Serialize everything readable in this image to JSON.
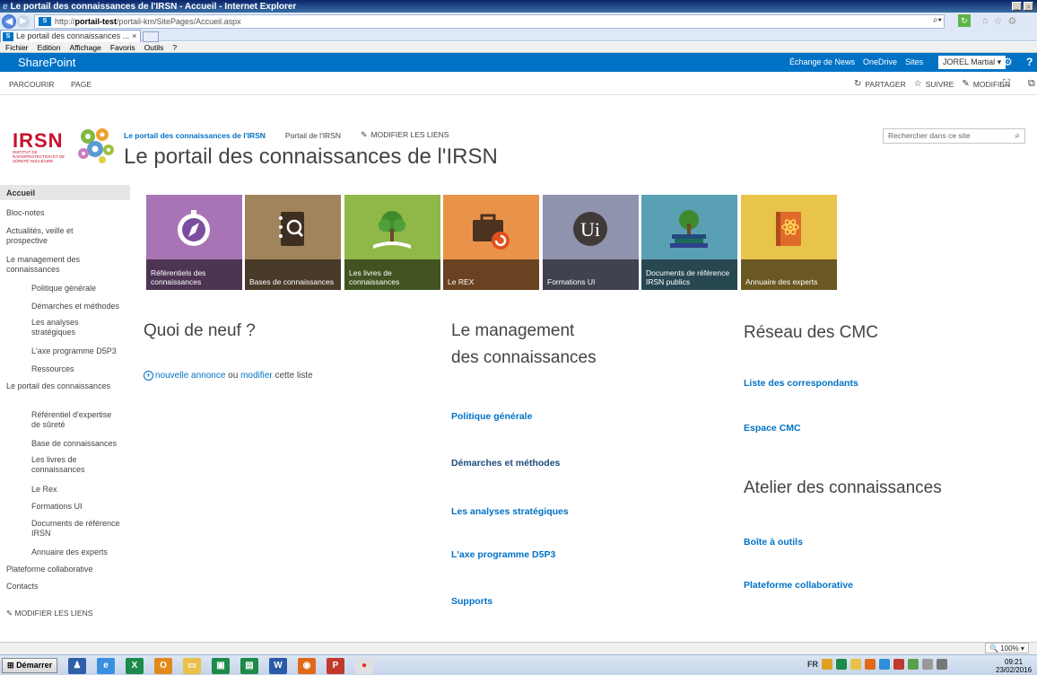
{
  "window": {
    "title": "Le portail des connaissances de l'IRSN - Accueil - Internet Explorer",
    "url_prefix": "http://",
    "url_host": "portail-test",
    "url_path": "/portail-km/SitePages/Accueil.aspx",
    "tab_label": "Le portail des connaissances ...",
    "tab_close": "×",
    "menu": [
      "Fichier",
      "Edition",
      "Affichage",
      "Favoris",
      "Outils",
      "?"
    ]
  },
  "suitebar": {
    "brand": "SharePoint",
    "links": [
      "Échange de News",
      "OneDrive",
      "Sites"
    ],
    "user": "JOREL Martial ▾",
    "help": "?"
  },
  "ribbon": {
    "tabs": [
      "PARCOURIR",
      "PAGE"
    ],
    "share": "PARTAGER",
    "follow": "SUIVRE",
    "edit": "MODIFIER"
  },
  "header": {
    "logo_text": "IRSN",
    "logo_sub": "Institut de radioprotection et de sûreté nucléaire",
    "site_link": "Le portail des connaissances de l'IRSN",
    "portal_link": "Portail de l'IRSN",
    "edit_links": "MODIFIER LES LIENS",
    "title": "Le portail des connaissances de l'IRSN",
    "search_placeholder": "Rechercher dans ce site"
  },
  "leftnav": {
    "items": [
      {
        "label": "Accueil",
        "level": 1,
        "selected": true
      },
      {
        "label": "Bloc-notes",
        "level": 1
      },
      {
        "label": "Actualités, veille et prospective",
        "level": 1
      },
      {
        "label": "Le management des connaissances",
        "level": 1
      },
      {
        "label": "Politique générale",
        "level": 2
      },
      {
        "label": "Démarches et méthodes",
        "level": 2
      },
      {
        "label": "Les analyses stratégiques",
        "level": 2
      },
      {
        "label": "L'axe programme D5P3",
        "level": 2
      },
      {
        "label": "Ressources",
        "level": 2
      },
      {
        "label": "Le portail des connaissances",
        "level": 1
      },
      {
        "label": "Référentiel d'expertise de sûreté",
        "level": 2
      },
      {
        "label": "Base de connaissances",
        "level": 2
      },
      {
        "label": "Les livres de connaissances",
        "level": 2
      },
      {
        "label": "Le Rex",
        "level": 2
      },
      {
        "label": "Formations UI",
        "level": 2
      },
      {
        "label": "Documents de référence IRSN",
        "level": 2
      },
      {
        "label": "Annuaire des experts",
        "level": 2
      },
      {
        "label": "Plateforme collaborative",
        "level": 1
      },
      {
        "label": "Contacts",
        "level": 1
      }
    ],
    "edit_links": "MODIFIER LES LIENS"
  },
  "tiles": [
    {
      "label": "Référentiels des connaissances",
      "color": "#a874b5",
      "icon": "compass-icon"
    },
    {
      "label": "Bases de connaissances",
      "color": "#a0845c",
      "icon": "notebook-search-icon"
    },
    {
      "label": "Les livres de connaissances",
      "color": "#8fb848",
      "icon": "tree-book-icon"
    },
    {
      "label": "Le REX",
      "color": "#e9934a",
      "icon": "briefcase-refresh-icon"
    },
    {
      "label": "Formations UI",
      "color": "#8f93ad",
      "icon": "ui-badge-icon"
    },
    {
      "label": "Documents de référence IRSN publics",
      "color": "#5aa0b4",
      "icon": "books-tree-icon"
    },
    {
      "label": "Annuaire des experts",
      "color": "#e8c44a",
      "icon": "atom-book-icon"
    }
  ],
  "news": {
    "title": "Quoi de neuf ?",
    "new_item": "nouvelle annonce",
    "or": " ou ",
    "modify": "modifier",
    "suffix": " cette liste"
  },
  "km": {
    "title_line1": "Le management",
    "title_line2": "des connaissances",
    "links": [
      "Politique générale",
      "Démarches et méthodes",
      "Les analyses stratégiques",
      "L'axe programme D5P3",
      "Supports"
    ]
  },
  "cmc": {
    "title": "Réseau des CMC",
    "links": [
      "Liste des correspondants",
      "Espace CMC"
    ]
  },
  "atelier": {
    "title": "Atelier des connaissances",
    "links": [
      "Boîte à outils",
      "Plateforme collaborative"
    ]
  },
  "status": {
    "zoom": "100%"
  },
  "taskbar": {
    "start": "Démarrer",
    "lang": "FR",
    "time": "09:21",
    "date": "23/02/2016"
  }
}
